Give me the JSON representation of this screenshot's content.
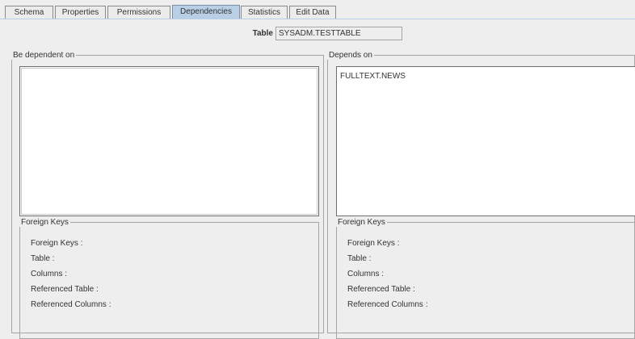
{
  "tabs": [
    {
      "label": "Schema",
      "active": false
    },
    {
      "label": "Properties",
      "active": false
    },
    {
      "label": "Permissions",
      "active": false
    },
    {
      "label": "Dependencies",
      "active": true
    },
    {
      "label": "Statistics",
      "active": false
    },
    {
      "label": "Edit Data",
      "active": false
    }
  ],
  "table": {
    "label": "Table",
    "value": "SYSADM.TESTTABLE"
  },
  "left": {
    "title": "Be dependent on",
    "items": [],
    "fk": {
      "title": "Foreign Keys",
      "rows": [
        "Foreign Keys :",
        "Table :",
        "Columns :",
        "Referenced Table :",
        "Referenced Columns :"
      ]
    }
  },
  "right": {
    "title": "Depends on",
    "items": [
      "FULLTEXT.NEWS"
    ],
    "fk": {
      "title": "Foreign Keys",
      "rows": [
        "Foreign Keys :",
        "Table :",
        "Columns :",
        "Referenced Table :",
        "Referenced Columns :"
      ]
    }
  },
  "colors": {
    "active_tab": "#b8cfe5",
    "background": "#eeeeee",
    "list_background": "#ffffff"
  }
}
